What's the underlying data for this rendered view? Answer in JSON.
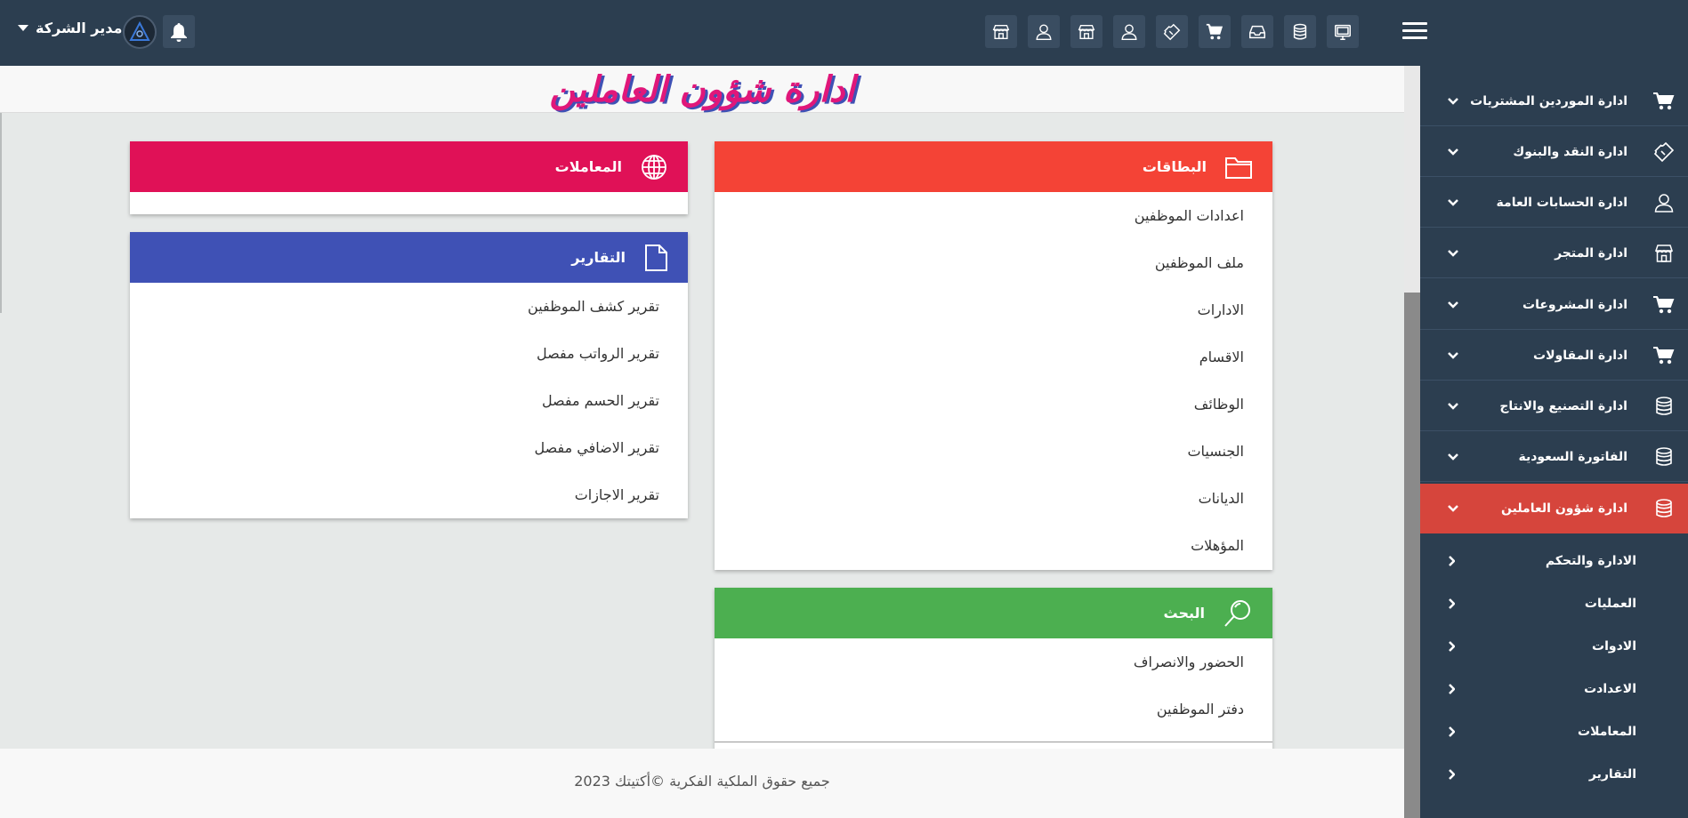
{
  "header": {
    "user_name": "مدير الشركة",
    "toolbar_icons": [
      "monitor-icon",
      "database-icon",
      "inbox-icon",
      "cart-icon",
      "ticket-icon",
      "user-icon",
      "store-icon",
      "user-icon",
      "store-icon"
    ]
  },
  "page": {
    "title": "ادارة شؤون العاملين"
  },
  "panels": {
    "cards": {
      "title": "البطاقات",
      "color": "#f44336",
      "icon": "folder-icon",
      "items": [
        "اعدادات الموظفين",
        "ملف الموظفين",
        "الادارات",
        "الاقسام",
        "الوظائف",
        "الجنسيات",
        "الديانات",
        "المؤهلات"
      ]
    },
    "search": {
      "title": "البحث",
      "color": "#4caf50",
      "icon": "search-icon",
      "items": [
        "الحضور والانصراف",
        "دفتر الموظفين"
      ]
    },
    "transactions": {
      "title": "المعاملات",
      "color": "#e01157",
      "icon": "globe-icon"
    },
    "reports": {
      "title": "التقارير",
      "color": "#3f51b5",
      "icon": "document-icon",
      "items": [
        "تقرير كشف الموظفين",
        "تقرير الرواتب مفصل",
        "تقرير الحسم مفصل",
        "تقرير الاضافي مفصل",
        "تقرير الاجازات"
      ]
    }
  },
  "sidebar": {
    "items": [
      {
        "label": "ادارة الموردين المشتريات",
        "icon": "cart-icon"
      },
      {
        "label": "ادارة النقد والبنوك",
        "icon": "ticket-icon"
      },
      {
        "label": "ادارة الحسابات العامة",
        "icon": "user-icon"
      },
      {
        "label": "ادارة المتجر",
        "icon": "store-icon"
      },
      {
        "label": "ادارة المشروعات",
        "icon": "cart-icon"
      },
      {
        "label": "ادارة المقاولات",
        "icon": "cart-icon"
      },
      {
        "label": "ادارة التصنيع والانتاج",
        "icon": "database-icon"
      },
      {
        "label": "الفاتورة السعودية",
        "icon": "database-icon"
      },
      {
        "label": "ادارة شؤون العاملين",
        "icon": "database-icon",
        "active": true
      }
    ],
    "sub_items": [
      "الادارة والتحكم",
      "العمليات",
      "الادوات",
      "الاعدادت",
      "المعاملات",
      "التقارير"
    ],
    "active_color": "#d6453c"
  },
  "footer": {
    "text": "جميع حقوق الملكية الفكرية ©أكتيتك 2023"
  }
}
